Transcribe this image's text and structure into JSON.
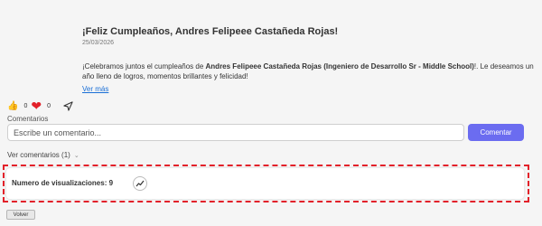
{
  "post": {
    "title": "¡Feliz Cumpleaños, Andres Felipeee Castañeda Rojas!",
    "date": "25/03/2026",
    "body_intro": "¡Celebramos juntos el cumpleaños de ",
    "body_name": "Andres Felipeee Castañeda Rojas (Ingeniero de Desarrollo Sr - Middle School)",
    "body_outro": "!. Le deseamos un año lleno de logros, momentos brillantes y felicidad!",
    "see_more": "Ver más"
  },
  "reactions": {
    "like_icon": "thumbs-up-icon",
    "like_count": "0",
    "heart_icon": "heart-icon",
    "heart_count": "0",
    "share_icon": "send-icon"
  },
  "comments": {
    "label": "Comentarios",
    "placeholder": "Escribe un comentario...",
    "submit_label": "Comentar",
    "view_label": "Ver comentarios (1)",
    "chevron_icon": "chevron-down-icon"
  },
  "views": {
    "label": "Numero de visualizaciones: 9",
    "icon": "trend-chart-icon"
  },
  "footer": {
    "back_label": "Volver"
  },
  "colors": {
    "accent": "#6b6cf0",
    "link": "#1a6fd6",
    "heart": "#e2212a",
    "highlight": "#e2212a"
  }
}
